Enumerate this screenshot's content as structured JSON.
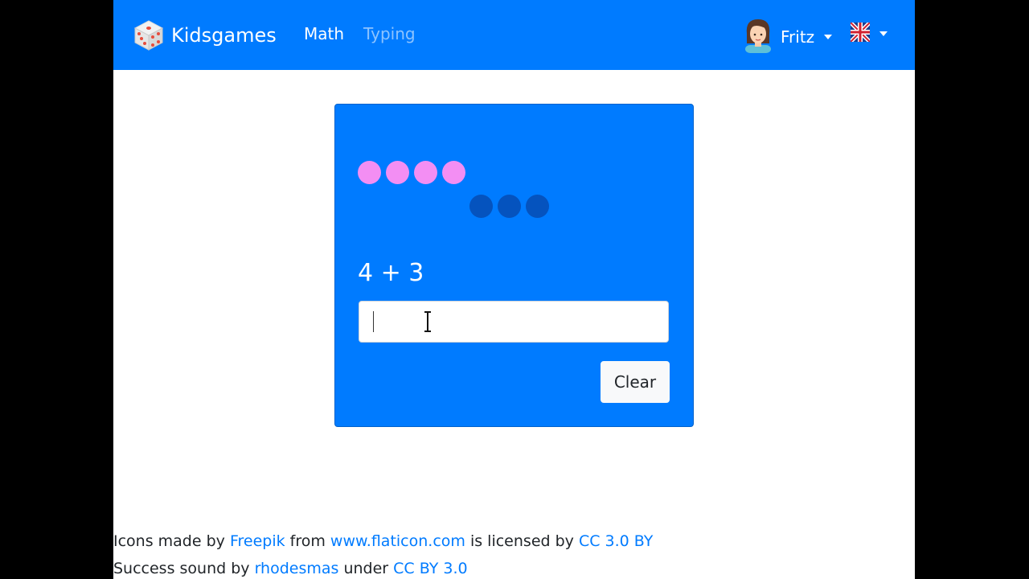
{
  "app": {
    "brand": "Kidsgames",
    "brand_icon": "dice-icon"
  },
  "nav": {
    "math": "Math",
    "typing": "Typing"
  },
  "user": {
    "name": "Fritz",
    "avatar_icon": "girl-avatar-icon"
  },
  "language": {
    "selected": "English",
    "flag_icon": "uk-flag-icon"
  },
  "game": {
    "left_count": 4,
    "right_count": 3,
    "equation": "4 + 3",
    "answer_value": "",
    "clear_label": "Clear",
    "colors": {
      "card": "#007bff",
      "left_dots": "#f38ef3",
      "right_dots": "#0553be"
    }
  },
  "footer": {
    "line1": {
      "prefix": "Icons made by ",
      "author": "Freepik",
      "middle": " from ",
      "site": "www.flaticon.com",
      "middle2": " is licensed by ",
      "license": "CC 3.0 BY"
    },
    "line2": {
      "prefix": "Success sound by ",
      "author": "rhodesmas",
      "middle": " under ",
      "license": "CC BY 3.0"
    }
  }
}
